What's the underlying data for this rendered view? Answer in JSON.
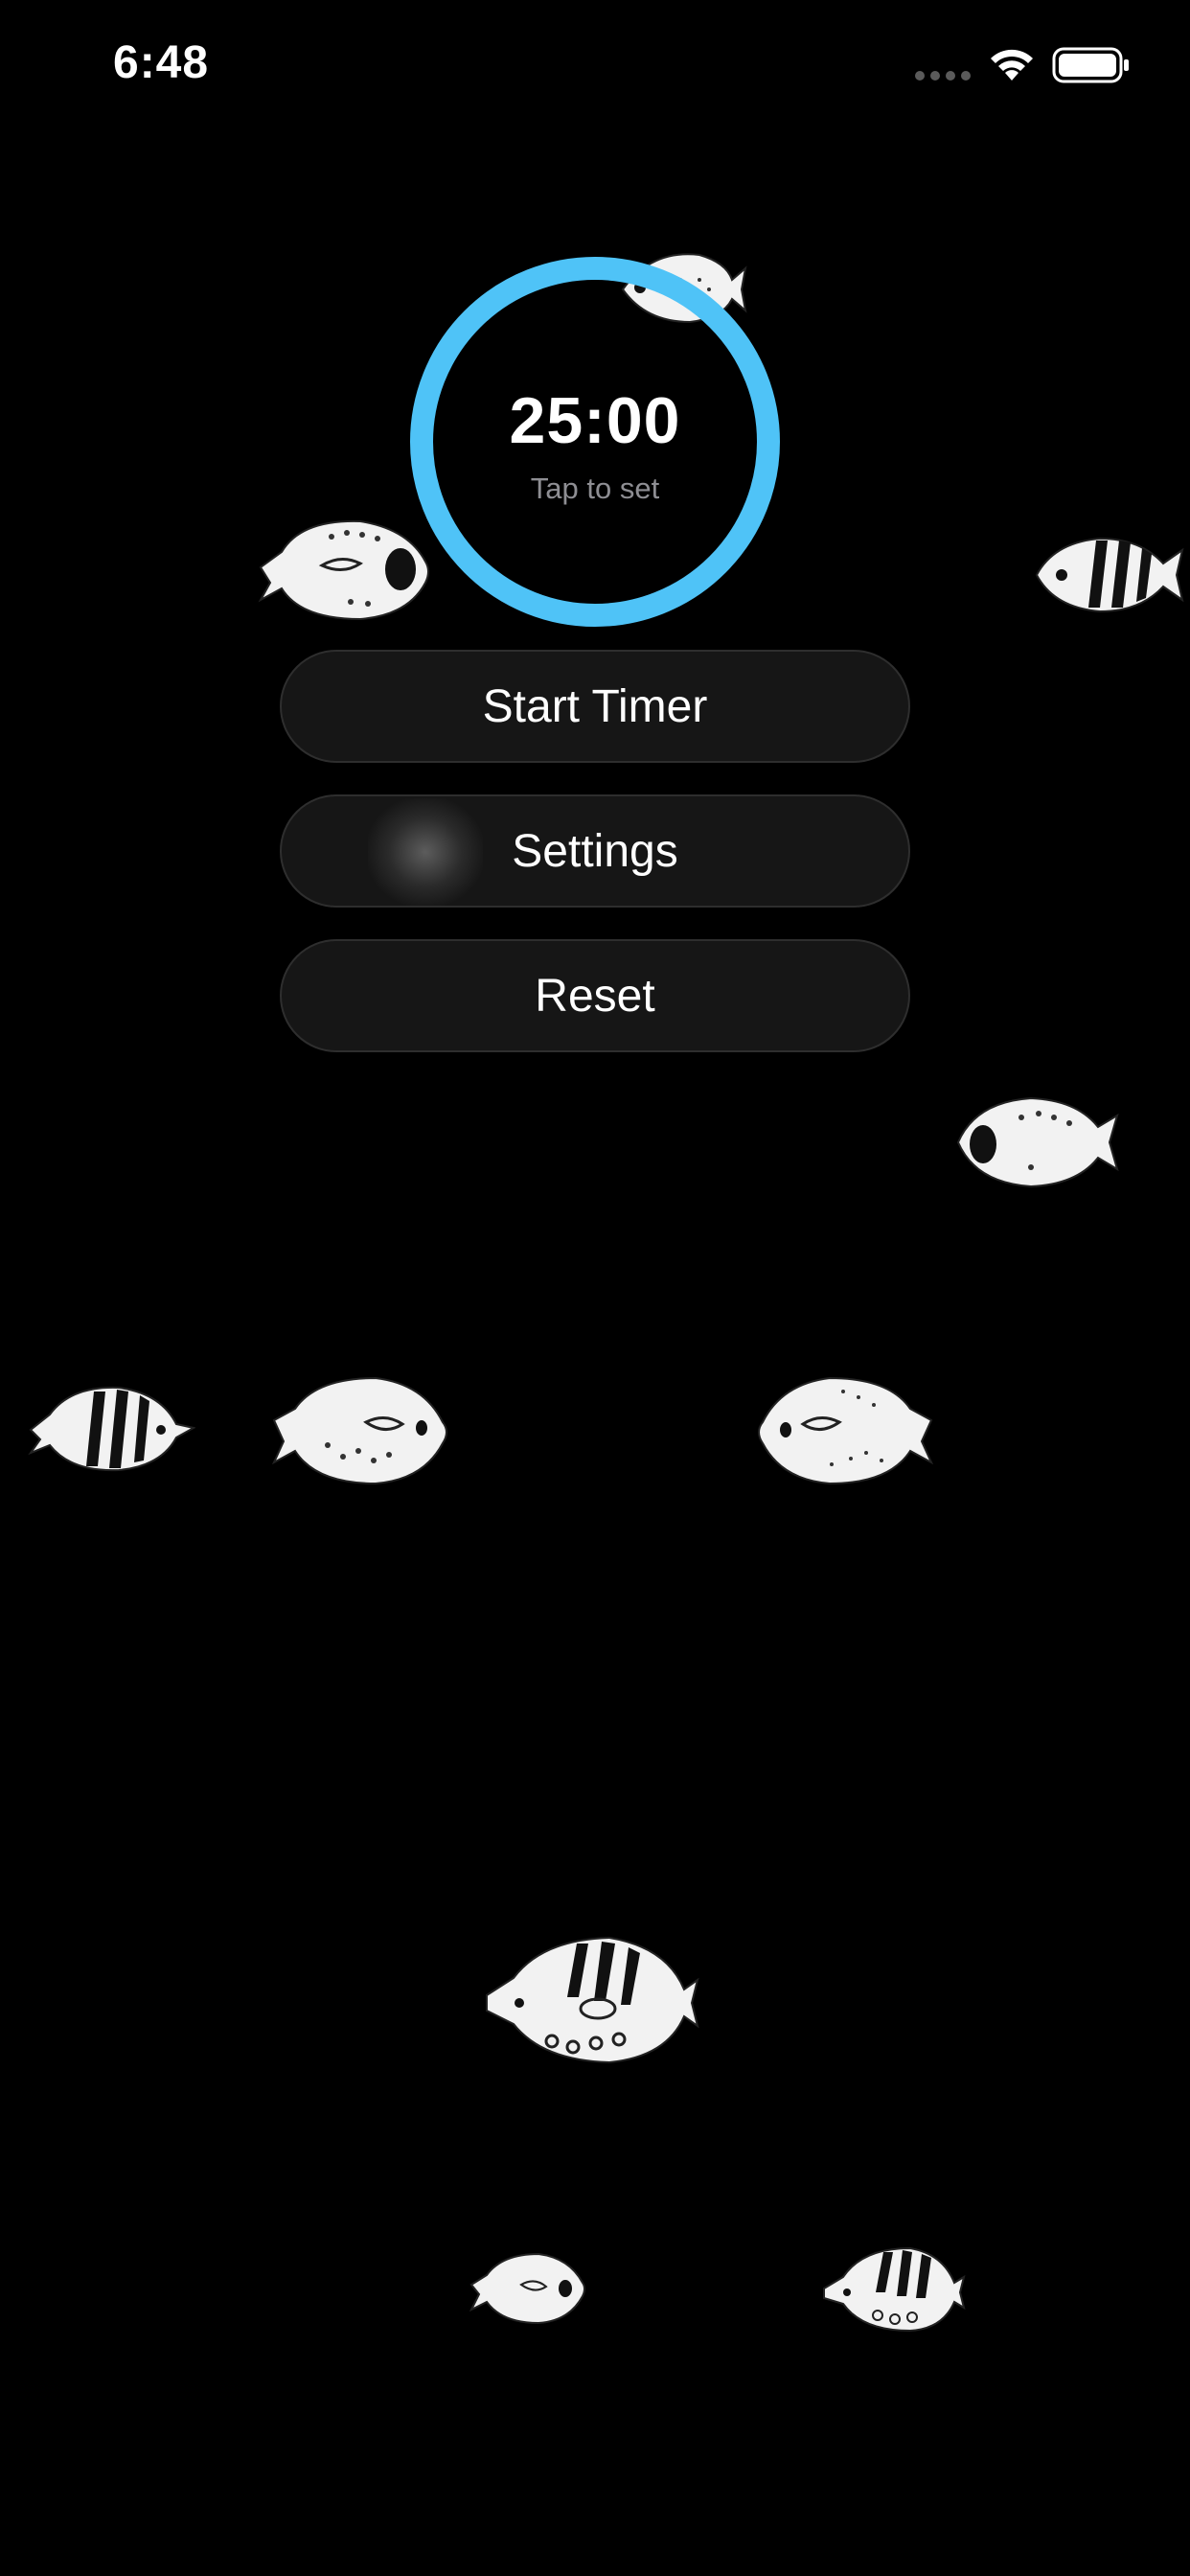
{
  "status_bar": {
    "time": "6:48",
    "icons": [
      "signal-icon",
      "wifi-icon",
      "battery-icon"
    ]
  },
  "timer": {
    "value": "25:00",
    "hint": "Tap to set",
    "ring_color": "#4fc3f7"
  },
  "buttons": {
    "start": "Start Timer",
    "settings": "Settings",
    "reset": "Reset"
  },
  "decorations": {
    "fish_icon": "fish-icon"
  }
}
